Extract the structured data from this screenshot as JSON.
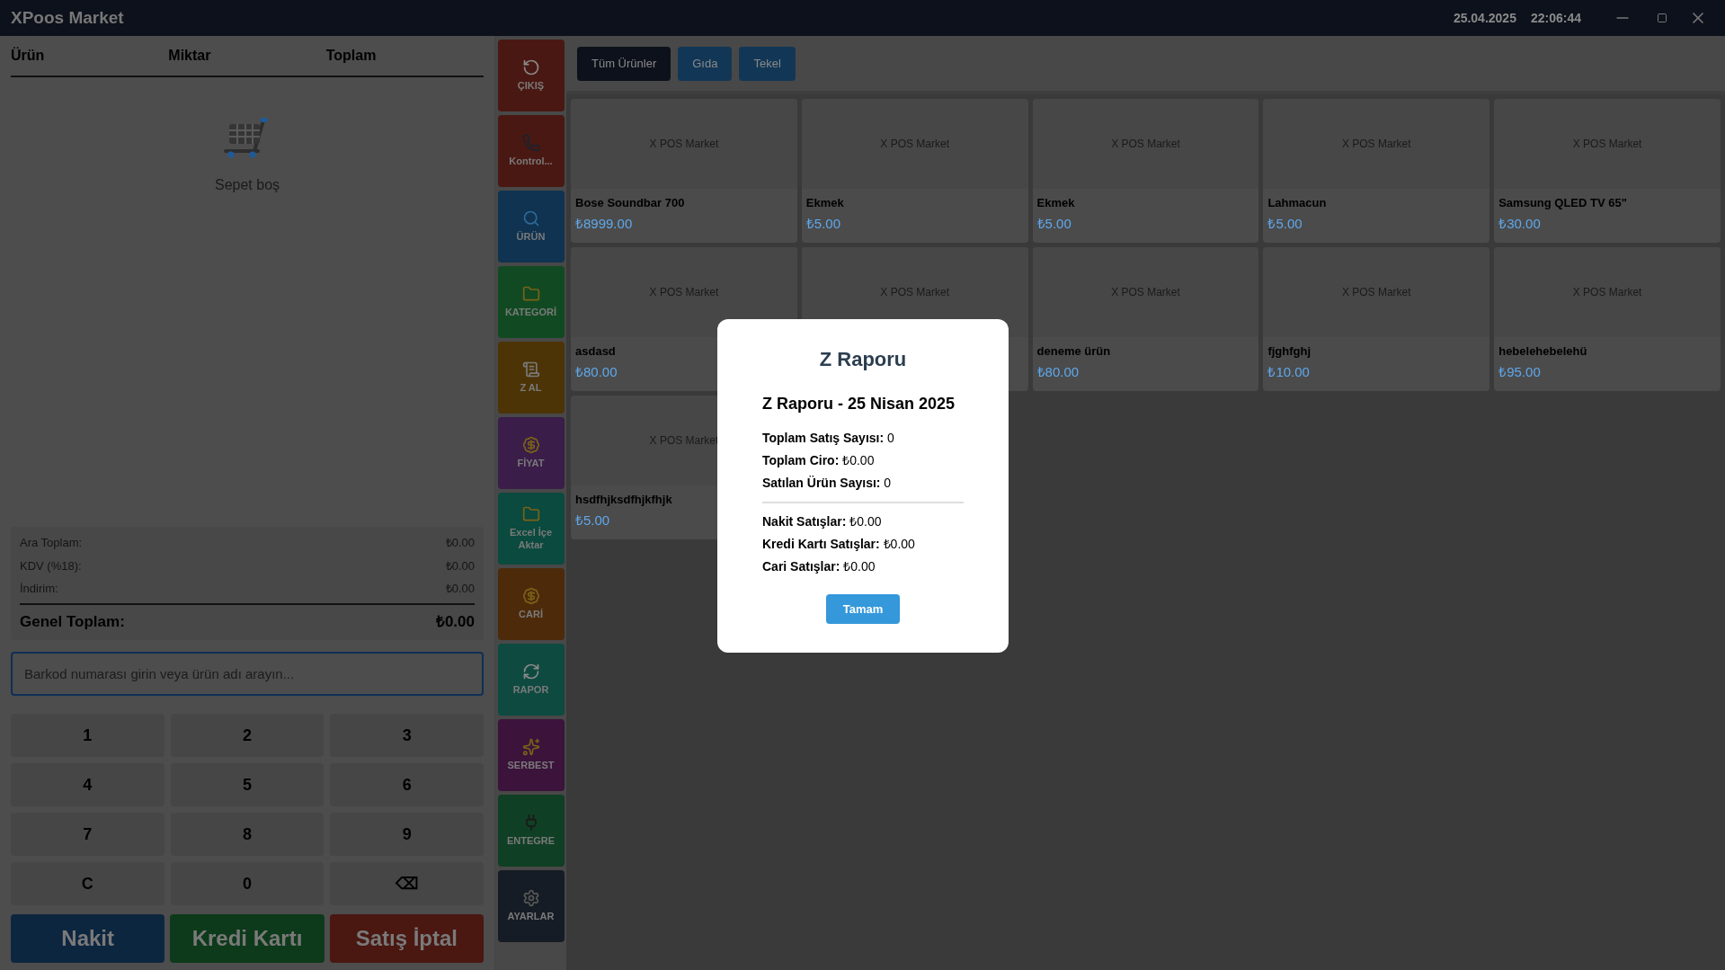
{
  "window": {
    "title": "XPoos Market",
    "date": "25.04.2025",
    "time": "22:06:44"
  },
  "cart": {
    "columns": [
      "Ürün",
      "Miktar",
      "Toplam"
    ],
    "empty_text": "Sepet boş",
    "summary": [
      {
        "label": "Ara Toplam:",
        "value": "₺0.00"
      },
      {
        "label": "KDV (%18):",
        "value": "₺0.00"
      },
      {
        "label": "İndirim:",
        "value": "₺0.00"
      }
    ],
    "grand_total": {
      "label": "Genel Toplam:",
      "value": "₺0.00"
    },
    "search": {
      "placeholder": "Barkod numarası girin veya ürün adı arayın..."
    },
    "keypad": [
      "1",
      "2",
      "3",
      "4",
      "5",
      "6",
      "7",
      "8",
      "9",
      "C",
      "0",
      "⌫"
    ],
    "actions": [
      {
        "label": "Nakit",
        "color": "#0d2640"
      },
      {
        "label": "Kredi Kartı",
        "color": "#0d3a1a"
      },
      {
        "label": "Satış İptal",
        "color": "#4a1711"
      }
    ]
  },
  "menu": [
    {
      "label": "ÇIKIŞ",
      "color": "#4a1812"
    },
    {
      "label": "Kontrol...",
      "color": "#4a1812"
    },
    {
      "label": "ÜRÜN",
      "color": "#0f3350"
    },
    {
      "label": "KATEGORİ",
      "color": "#114a22"
    },
    {
      "label": "Z AL",
      "color": "#4d3406"
    },
    {
      "label": "FİYAT",
      "color": "#3a1d49"
    },
    {
      "label": "Excel İçe Aktar",
      "color": "#0b4a3e"
    },
    {
      "label": "CARİ",
      "color": "#4d2a0a"
    },
    {
      "label": "RAPOR",
      "color": "#0e4a40"
    },
    {
      "label": "SERBEST",
      "color": "#3b133b"
    },
    {
      "label": "ENTEGRE",
      "color": "#0f3f24"
    },
    {
      "label": "AYARLAR",
      "color": "#161c25"
    }
  ],
  "categories": [
    {
      "label": "Tüm Ürünler",
      "selected": true
    },
    {
      "label": "Gıda",
      "selected": false
    },
    {
      "label": "Tekel",
      "selected": false
    }
  ],
  "products": [
    {
      "placeholder": "X POS Market",
      "name": "Bose Soundbar 700",
      "price": "₺8999.00"
    },
    {
      "placeholder": "X POS Market",
      "name": "Ekmek",
      "price": "₺5.00"
    },
    {
      "placeholder": "X POS Market",
      "name": "Ekmek",
      "price": "₺5.00"
    },
    {
      "placeholder": "X POS Market",
      "name": "Lahmacun",
      "price": "₺5.00"
    },
    {
      "placeholder": "X POS Market",
      "name": "Samsung QLED TV 65\"",
      "price": "₺30.00"
    },
    {
      "placeholder": "X POS Market",
      "name": "asdasd",
      "price": "₺80.00"
    },
    {
      "placeholder": "X POS Market"
    },
    {
      "placeholder": "X POS Market",
      "name": "deneme ürün",
      "price": "₺80.00"
    },
    {
      "placeholder": "X POS Market",
      "name": "fjghfghj",
      "price": "₺10.00"
    },
    {
      "placeholder": "X POS Market",
      "name": "hebelehebelehü",
      "price": "₺95.00"
    },
    {
      "placeholder": "X POS Market",
      "name": "hsdfhjksdfhjkfhjk",
      "price": "₺5.00"
    }
  ],
  "dialog": {
    "title": "Z Raporu",
    "subtitle": "Z Raporu - 25 Nisan 2025",
    "lines": [
      "**Toplam Satış Sayısı:** 0",
      "**Toplam Ciro:** ₺0.00",
      "**Satılan Ürün Sayısı:** 0"
    ],
    "payment_lines": [
      "**Nakit Satışlar:** ₺0.00",
      "**Kredi Kartı Satışlar:** ₺0.00",
      "**Cari Satışlar:** ₺0.00"
    ],
    "button": "Tamam"
  }
}
